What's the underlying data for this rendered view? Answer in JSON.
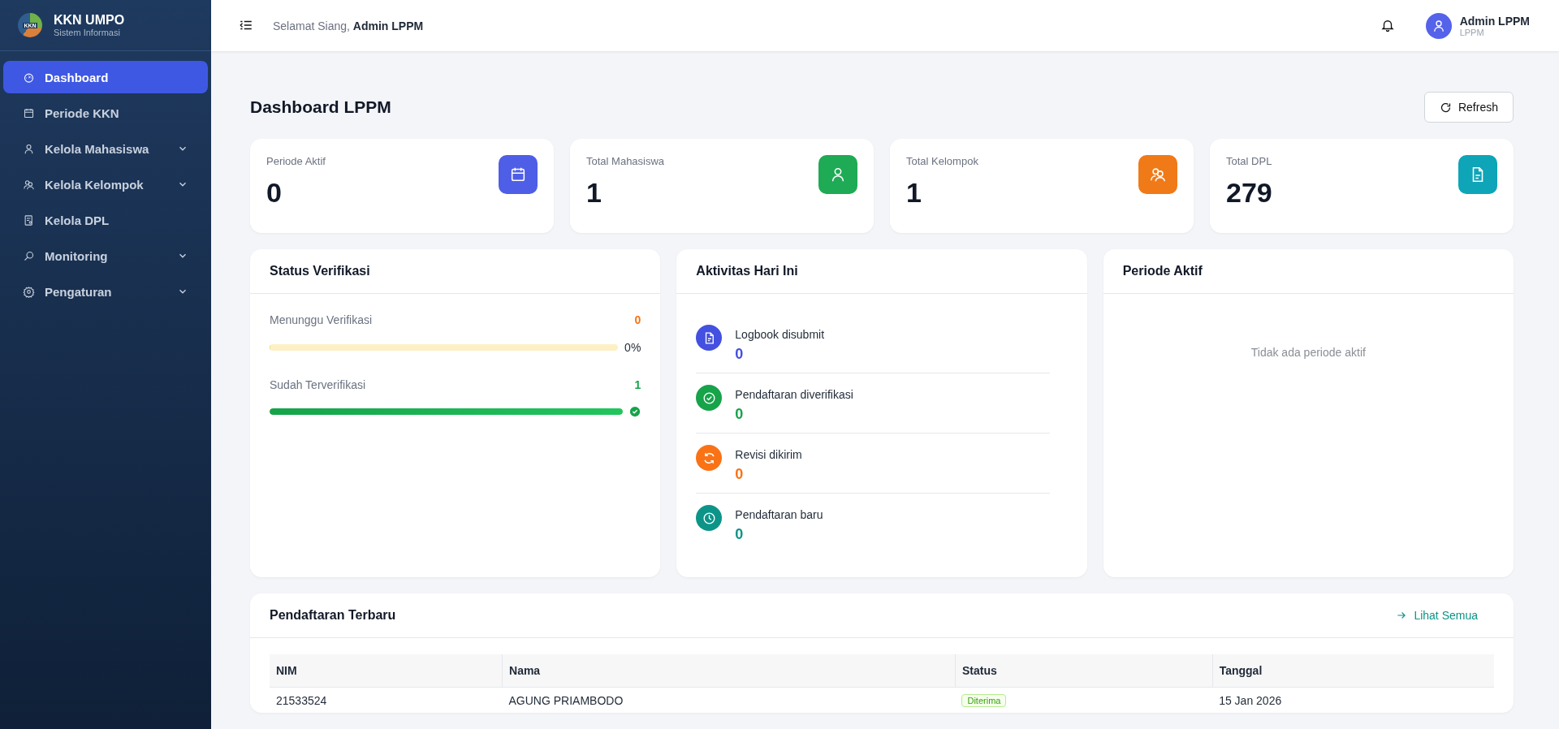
{
  "brand": {
    "title": "KKN UMPO",
    "subtitle": "Sistem Informasi",
    "logo_text": "KKN"
  },
  "sidebar": {
    "items": [
      {
        "label": "Dashboard",
        "selected": true,
        "expandable": false
      },
      {
        "label": "Periode KKN",
        "selected": false,
        "expandable": false
      },
      {
        "label": "Kelola Mahasiswa",
        "selected": false,
        "expandable": true
      },
      {
        "label": "Kelola Kelompok",
        "selected": false,
        "expandable": true
      },
      {
        "label": "Kelola DPL",
        "selected": false,
        "expandable": false
      },
      {
        "label": "Monitoring",
        "selected": false,
        "expandable": true
      },
      {
        "label": "Pengaturan",
        "selected": false,
        "expandable": true
      }
    ]
  },
  "header": {
    "greeting": "Selamat Siang,",
    "user_name": "Admin LPPM",
    "profile_name": "Admin LPPM",
    "profile_role": "LPPM"
  },
  "page_title": "Dashboard LPPM",
  "refresh_button": "Refresh",
  "stats": [
    {
      "label": "Periode Aktif",
      "value": "0",
      "color": "#4f5ee6"
    },
    {
      "label": "Total Mahasiswa",
      "value": "1",
      "color": "#1faa55"
    },
    {
      "label": "Total Kelompok",
      "value": "1",
      "color": "#f07a18"
    },
    {
      "label": "Total DPL",
      "value": "279",
      "color": "#0ea5b8"
    }
  ],
  "status_verifikasi": {
    "title": "Status Verifikasi",
    "items": [
      {
        "label": "Menunggu Verifikasi",
        "count": "0",
        "level": 0,
        "reading": "0%",
        "color": "#f97316"
      },
      {
        "label": "Sudah Terverifikasi",
        "count": "1",
        "level": 1,
        "color": "#16a34a"
      }
    ]
  },
  "aktivitas": {
    "title": "Aktivitas Hari Ini",
    "items": [
      {
        "label": "Logbook disubmit",
        "value": "0",
        "color": "#4350e0"
      },
      {
        "label": "Pendaftaran diverifikasi",
        "value": "0",
        "color": "#16a34a"
      },
      {
        "label": "Revisi dikirim",
        "value": "0",
        "color": "#f97316"
      },
      {
        "label": "Pendaftaran baru",
        "value": "0",
        "color": "#0d9488"
      }
    ]
  },
  "periode_aktif": {
    "title": "Periode Aktif",
    "empty_text": "Tidak ada periode aktif"
  },
  "pendaftaran": {
    "title": "Pendaftaran Terbaru",
    "link": "Lihat Semua",
    "columns": [
      "NIM",
      "Nama",
      "Status",
      "Tanggal"
    ],
    "rows": [
      {
        "nim": "21533524",
        "nama": "AGUNG PRIAMBODO",
        "status": "Diterima",
        "tanggal": "15 Jan 2026"
      }
    ]
  }
}
